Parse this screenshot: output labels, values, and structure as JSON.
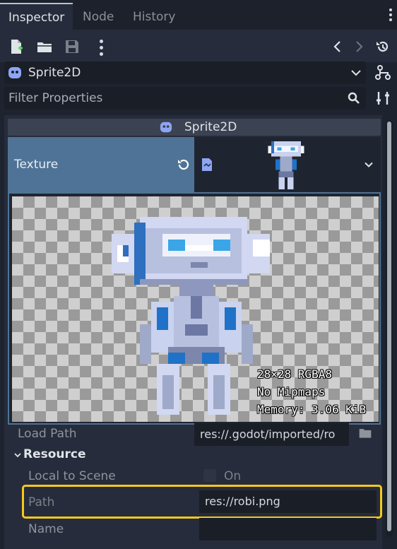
{
  "tabs": [
    {
      "label": "Inspector",
      "active": true
    },
    {
      "label": "Node",
      "active": false
    },
    {
      "label": "History",
      "active": false
    }
  ],
  "toolbar": {
    "icons": [
      "new-resource-icon",
      "open-folder-icon",
      "save-icon",
      "more-icon",
      "back-arrow-icon",
      "forward-arrow-icon",
      "history-icon"
    ]
  },
  "node_selector": {
    "label": "Sprite2D"
  },
  "filter": {
    "placeholder": "Filter Properties"
  },
  "header": {
    "title": "Sprite2D"
  },
  "texture": {
    "label": "Texture"
  },
  "preview": {
    "info_size": "28×28 RGBA8",
    "info_mipmaps": "No Mipmaps",
    "info_memory": "Memory: 3.06 KiB"
  },
  "load_path": {
    "label": "Load Path",
    "value": "res://.godot/imported/ro"
  },
  "resource": {
    "section_label": "Resource",
    "local_to_scene_label": "Local to Scene",
    "local_to_scene_value": "On",
    "path_label": "Path",
    "path_value": "res://robi.png",
    "name_label": "Name",
    "name_value": ""
  },
  "colors": {
    "accent": "#4f7396",
    "highlight": "#f3c91c",
    "panel": "#262c3b"
  }
}
